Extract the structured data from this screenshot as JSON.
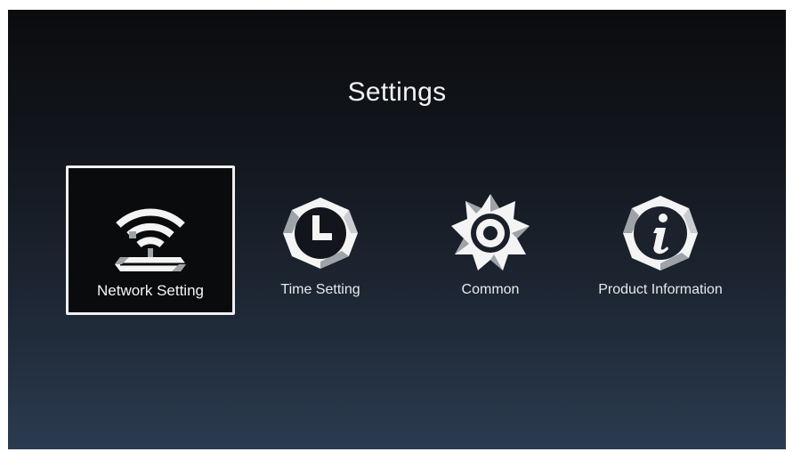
{
  "screen": {
    "title": "Settings"
  },
  "tiles": [
    {
      "label": "Network Setting",
      "icon": "wifi-router-icon",
      "selected": true
    },
    {
      "label": "Time Setting",
      "icon": "clock-icon",
      "selected": false
    },
    {
      "label": "Common",
      "icon": "gear-icon",
      "selected": false
    },
    {
      "label": "Product Information",
      "icon": "info-icon",
      "selected": false
    }
  ],
  "colors": {
    "background_top": "#0b0c0e",
    "background_bottom": "#2b3b50",
    "text": "#f2f2f2",
    "icon_light": "#f4f4f4",
    "icon_shade": "#9ea3a8",
    "selection_border": "#f0f0f0"
  }
}
